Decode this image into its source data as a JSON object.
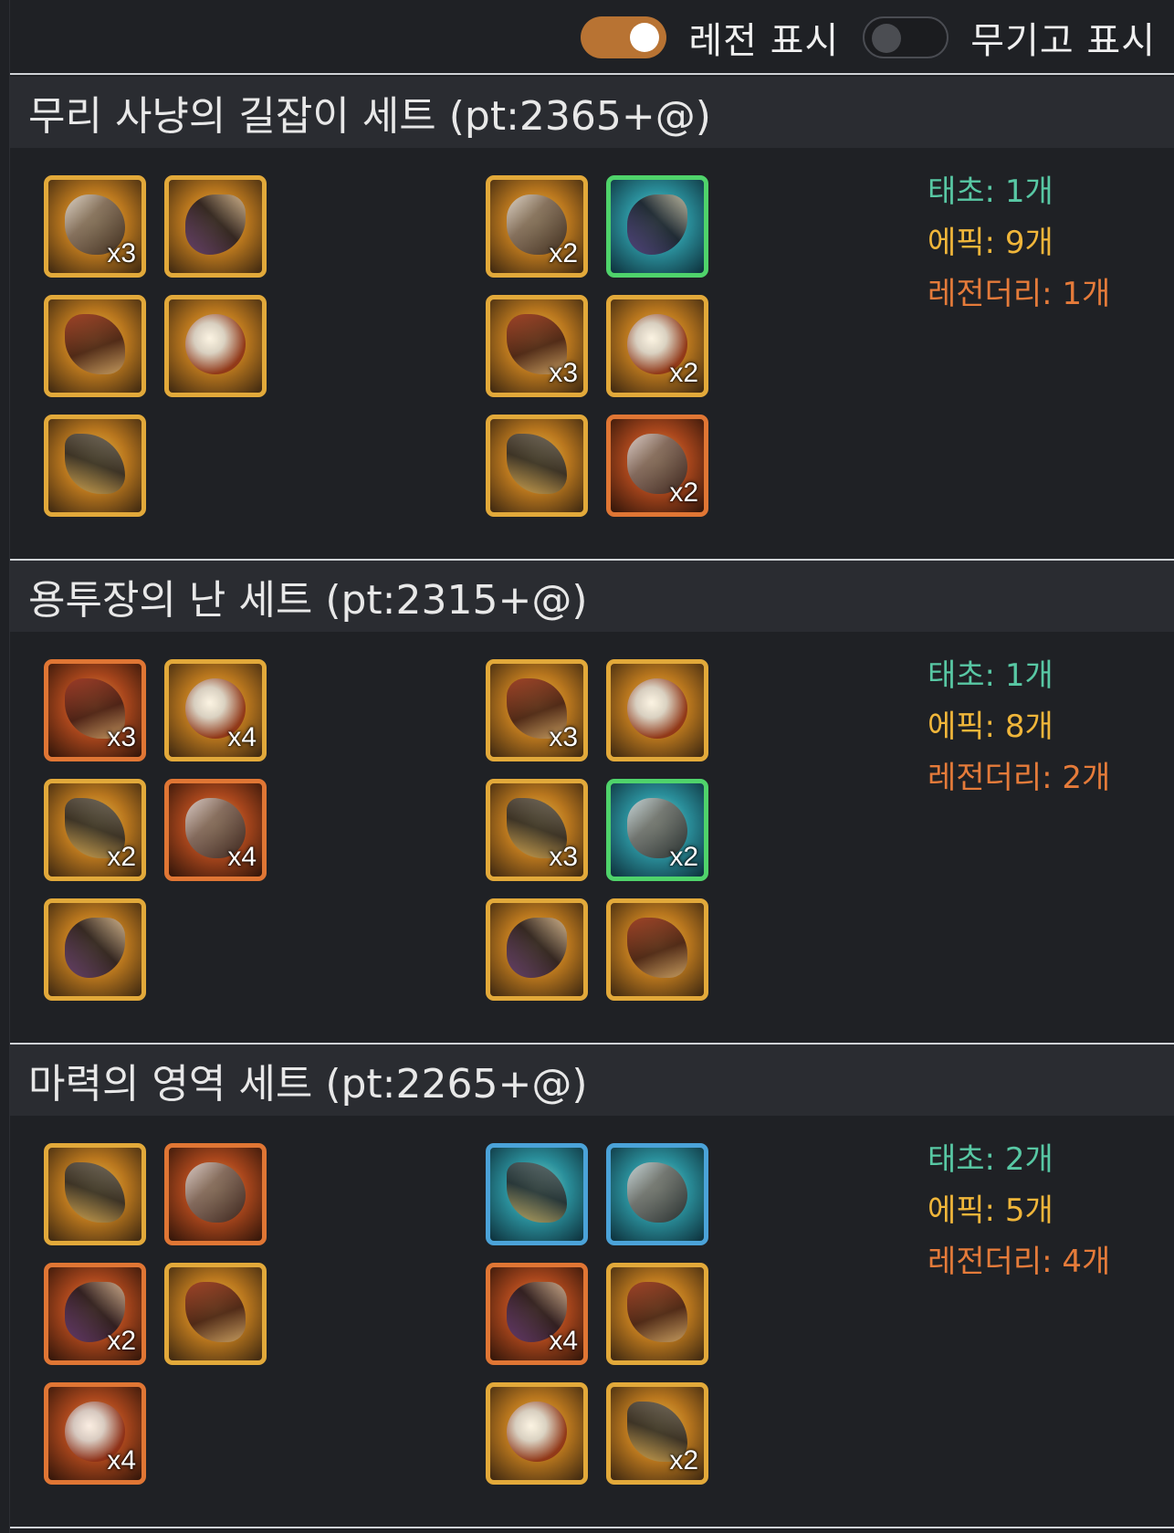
{
  "toggles": [
    {
      "label": "레전 표시",
      "on": true
    },
    {
      "label": "무기고 표시",
      "on": false
    }
  ],
  "colors": {
    "toggle_on": "#b87333",
    "epic_border": "#e2a93a",
    "legendary_border": "#e07634",
    "mythic_border": "#4ba3d9",
    "stat_mythic": "#58c8a4",
    "stat_epic": "#f0b63a",
    "stat_legendary": "#e57b3a"
  },
  "sets": [
    {
      "title": "무리 사냥의 길잡이 세트 (pt:2365+@)",
      "left_items": [
        {
          "grade": "epic",
          "icon": "hood-icon",
          "qty": "x3"
        },
        {
          "grade": "epic",
          "icon": "armor-icon",
          "qty": ""
        },
        {
          "grade": "epic",
          "icon": "pants-icon",
          "qty": ""
        },
        {
          "grade": "epic",
          "icon": "belt-icon",
          "qty": ""
        },
        {
          "grade": "epic",
          "icon": "boots-icon",
          "qty": ""
        }
      ],
      "right_items": [
        {
          "grade": "epic",
          "icon": "bracelet-icon",
          "qty": "x2"
        },
        {
          "grade": "mythic",
          "icon": "fang-necklace-icon",
          "qty": ""
        },
        {
          "grade": "epic",
          "icon": "axe-icon",
          "qty": "x3"
        },
        {
          "grade": "epic",
          "icon": "wolf-icon",
          "qty": "x2"
        },
        {
          "grade": "epic",
          "icon": "horn-icon",
          "qty": ""
        },
        {
          "grade": "legendary",
          "icon": "wolf-figure-icon",
          "qty": "x2"
        }
      ],
      "stats": {
        "mythic": "태초: 1개",
        "epic": "에픽: 9개",
        "legendary": "레전더리: 1개"
      }
    },
    {
      "title": "용투장의 난 세트 (pt:2315+@)",
      "left_items": [
        {
          "grade": "legendary",
          "icon": "wing-shoulder-icon",
          "qty": "x3"
        },
        {
          "grade": "epic",
          "icon": "chest-armor-icon",
          "qty": "x4"
        },
        {
          "grade": "epic",
          "icon": "leg-armor-icon",
          "qty": "x2"
        },
        {
          "grade": "legendary",
          "icon": "claw-belt-icon",
          "qty": "x4"
        },
        {
          "grade": "epic",
          "icon": "claw-boots-icon",
          "qty": ""
        }
      ],
      "right_items": [
        {
          "grade": "epic",
          "icon": "claw-bracelet-icon",
          "qty": "x3"
        },
        {
          "grade": "epic",
          "icon": "dragon-necklace-icon",
          "qty": ""
        },
        {
          "grade": "epic",
          "icon": "blade-icon",
          "qty": "x3"
        },
        {
          "grade": "mythic",
          "icon": "scale-ring-icon",
          "qty": "x2"
        },
        {
          "grade": "epic",
          "icon": "scythe-icon",
          "qty": ""
        },
        {
          "grade": "epic",
          "icon": "pearl-icon",
          "qty": ""
        }
      ],
      "stats": {
        "mythic": "태초: 1개",
        "epic": "에픽: 8개",
        "legendary": "레전더리: 2개"
      }
    },
    {
      "title": "마력의 영역 세트 (pt:2265+@)",
      "left_items": [
        {
          "grade": "epic",
          "icon": "witch-hat-icon",
          "qty": ""
        },
        {
          "grade": "legendary",
          "icon": "robe-icon",
          "qty": ""
        },
        {
          "grade": "legendary",
          "icon": "greaves-icon",
          "qty": "x2"
        },
        {
          "grade": "epic",
          "icon": "magic-belt-icon",
          "qty": ""
        },
        {
          "grade": "legendary",
          "icon": "magic-boots-icon",
          "qty": "x4"
        }
      ],
      "right_items": [
        {
          "grade": "mythic",
          "icon": "ring-bracelet-icon",
          "qty": ""
        },
        {
          "grade": "mythic",
          "icon": "flame-necklace-icon",
          "qty": ""
        },
        {
          "grade": "legendary",
          "icon": "candle-icon",
          "qty": "x4"
        },
        {
          "grade": "epic",
          "icon": "lattice-ring-icon",
          "qty": ""
        },
        {
          "grade": "epic",
          "icon": "orb-staff-icon",
          "qty": ""
        },
        {
          "grade": "epic",
          "icon": "crystal-orb-icon",
          "qty": "x2"
        }
      ],
      "stats": {
        "mythic": "태초: 2개",
        "epic": "에픽: 5개",
        "legendary": "레전더리: 4개"
      }
    }
  ]
}
